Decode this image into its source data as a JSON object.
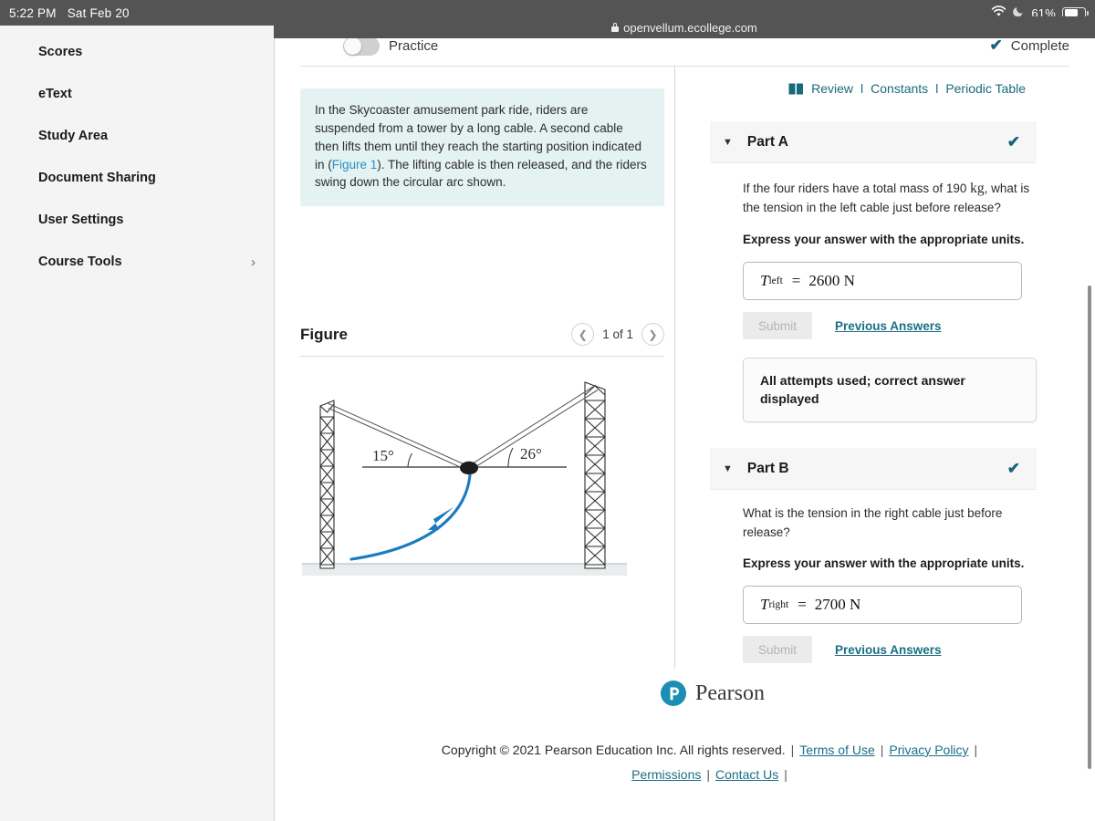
{
  "statusbar": {
    "time": "5:22 PM",
    "date": "Sat Feb 20",
    "battery_percent": "61%",
    "wifi_icon": "wifi-icon",
    "dnd_icon": "moon-icon",
    "battery_icon": "battery-icon"
  },
  "browser": {
    "url": "openvellum.ecollege.com",
    "lock_icon": "lock-icon"
  },
  "sidebar": {
    "items": [
      {
        "label": "Scores",
        "chevron": ""
      },
      {
        "label": "eText",
        "chevron": ""
      },
      {
        "label": "Study Area",
        "chevron": ""
      },
      {
        "label": "Document Sharing",
        "chevron": ""
      },
      {
        "label": "User Settings",
        "chevron": ""
      },
      {
        "label": "Course Tools",
        "chevron": "›"
      }
    ]
  },
  "topbar": {
    "practice_label": "Practice",
    "complete_label": "Complete",
    "complete_check": "✔"
  },
  "prompt": {
    "text_before_link": "In the Skycoaster amusement park ride, riders are suspended from a tower by a long cable. A second cable then lifts them until they reach the starting position indicated in (",
    "link": "Figure 1",
    "text_after_link": "). The lifting cable is then released, and the riders swing down the circular arc shown."
  },
  "figure": {
    "title": "Figure",
    "counter": "1 of 1",
    "prev_icon": "chevron-left-icon",
    "next_icon": "chevron-right-icon",
    "angle_left": "15°",
    "angle_right": "26°",
    "arc_color": "#1a7bbf"
  },
  "review_row": {
    "book_icon": "book-icon",
    "links": [
      "Review",
      "Constants",
      "Periodic Table"
    ],
    "separator": "l",
    "color": "#176b7d"
  },
  "parts": [
    {
      "title": "Part A",
      "caret": "▼",
      "check": "✔",
      "question_a": "If the four riders have a total mass of 190 ",
      "question_unit": "kg",
      "question_b": ", what is the tension in the left cable just before release?",
      "instruction": "Express your answer with the appropriate units.",
      "answer_var": "T",
      "answer_sub": "left",
      "answer_eq": "=",
      "answer_value": "2600 N",
      "submit_label": "Submit",
      "previous_label": "Previous Answers",
      "status_message": "All attempts used; correct answer displayed"
    },
    {
      "title": "Part B",
      "caret": "▼",
      "check": "✔",
      "question_a": "What is the tension in the right cable just before release?",
      "question_unit": "",
      "question_b": "",
      "instruction": "Express your answer with the appropriate units.",
      "answer_var": "T",
      "answer_sub": "right",
      "answer_eq": "=",
      "answer_value": "2700 N",
      "submit_label": "Submit",
      "previous_label": "Previous Answers",
      "status_message": ""
    }
  ],
  "footer": {
    "brand": "Pearson",
    "copyright": "Copyright © 2021 Pearson Education Inc. All rights reserved.",
    "links": [
      "Terms of Use",
      "Privacy Policy",
      "Permissions",
      "Contact Us"
    ],
    "brand_color": "#1a8fb3"
  }
}
